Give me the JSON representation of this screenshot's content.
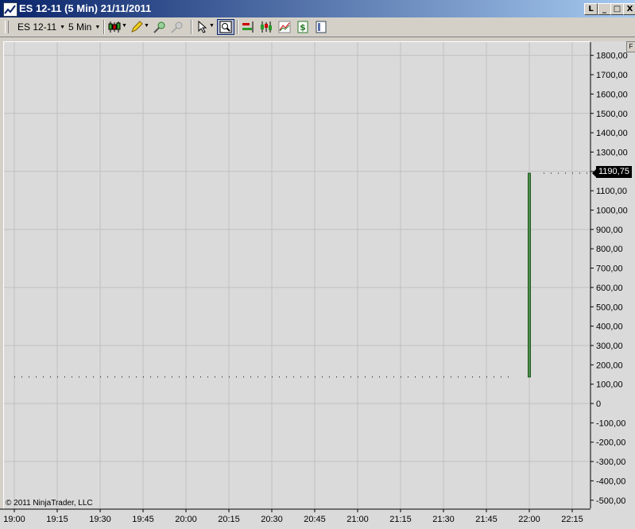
{
  "window": {
    "title": "ES 12-11 (5 Min)  21/11/2011",
    "buttons": {
      "minimize": "_",
      "maximize": "□",
      "close": "X",
      "extra": "L"
    }
  },
  "toolbar": {
    "instrument": "ES 12-11",
    "interval": "5 Min",
    "icons": [
      "candlestick-icon",
      "pencil-icon",
      "zoom-in-icon",
      "zoom-out-icon",
      "pointer-icon",
      "magnify-icon",
      "bars-icon",
      "indicator-icon",
      "strategy-icon",
      "dollar-icon",
      "properties-icon"
    ]
  },
  "chart": {
    "copyright": "© 2011 NinjaTrader, LLC",
    "last_price_label": "1190,75",
    "scroll_label": "F",
    "colors": {
      "background": "#dadada",
      "grid": "#c0c0c0",
      "bar": "#1e5a1e",
      "dots": "#000000"
    }
  },
  "chart_data": {
    "type": "line",
    "price_ticks": [
      {
        "value": 1800,
        "label": "1800,00"
      },
      {
        "value": 1700,
        "label": "1700,00"
      },
      {
        "value": 1600,
        "label": "1600,00"
      },
      {
        "value": 1500,
        "label": "1500,00"
      },
      {
        "value": 1400,
        "label": "1400,00"
      },
      {
        "value": 1300,
        "label": "1300,00"
      },
      {
        "value": 1200,
        "label": "1200,00"
      },
      {
        "value": 1100,
        "label": "1100,00"
      },
      {
        "value": 1000,
        "label": "1000,00"
      },
      {
        "value": 900,
        "label": "900,00"
      },
      {
        "value": 800,
        "label": "800,00"
      },
      {
        "value": 700,
        "label": "700,00"
      },
      {
        "value": 600,
        "label": "600,00"
      },
      {
        "value": 500,
        "label": "500,00"
      },
      {
        "value": 400,
        "label": "400,00"
      },
      {
        "value": 300,
        "label": "300,00"
      },
      {
        "value": 200,
        "label": "200,00"
      },
      {
        "value": 100,
        "label": "100,00"
      },
      {
        "value": 0,
        "label": "0"
      },
      {
        "value": -100,
        "label": "-100,00"
      },
      {
        "value": -200,
        "label": "-200,00"
      },
      {
        "value": -300,
        "label": "-300,00"
      },
      {
        "value": -400,
        "label": "-400,00"
      },
      {
        "value": -500,
        "label": "-500,00"
      }
    ],
    "time_ticks": [
      "19:00",
      "19:15",
      "19:30",
      "19:45",
      "20:00",
      "20:15",
      "20:30",
      "20:45",
      "21:00",
      "21:15",
      "21:30",
      "21:45",
      "22:00",
      "22:15"
    ],
    "ylim": [
      -510,
      1845
    ],
    "bar": {
      "time": "22:00",
      "open": 137,
      "high": 1190.75,
      "low": 137,
      "close": 1190.75
    },
    "dotted_before": {
      "from": "19:00",
      "to": "21:55",
      "value": 137
    },
    "dotted_after": {
      "from": "22:05",
      "to": "22:20",
      "value": 1190.75
    },
    "grid": true
  }
}
